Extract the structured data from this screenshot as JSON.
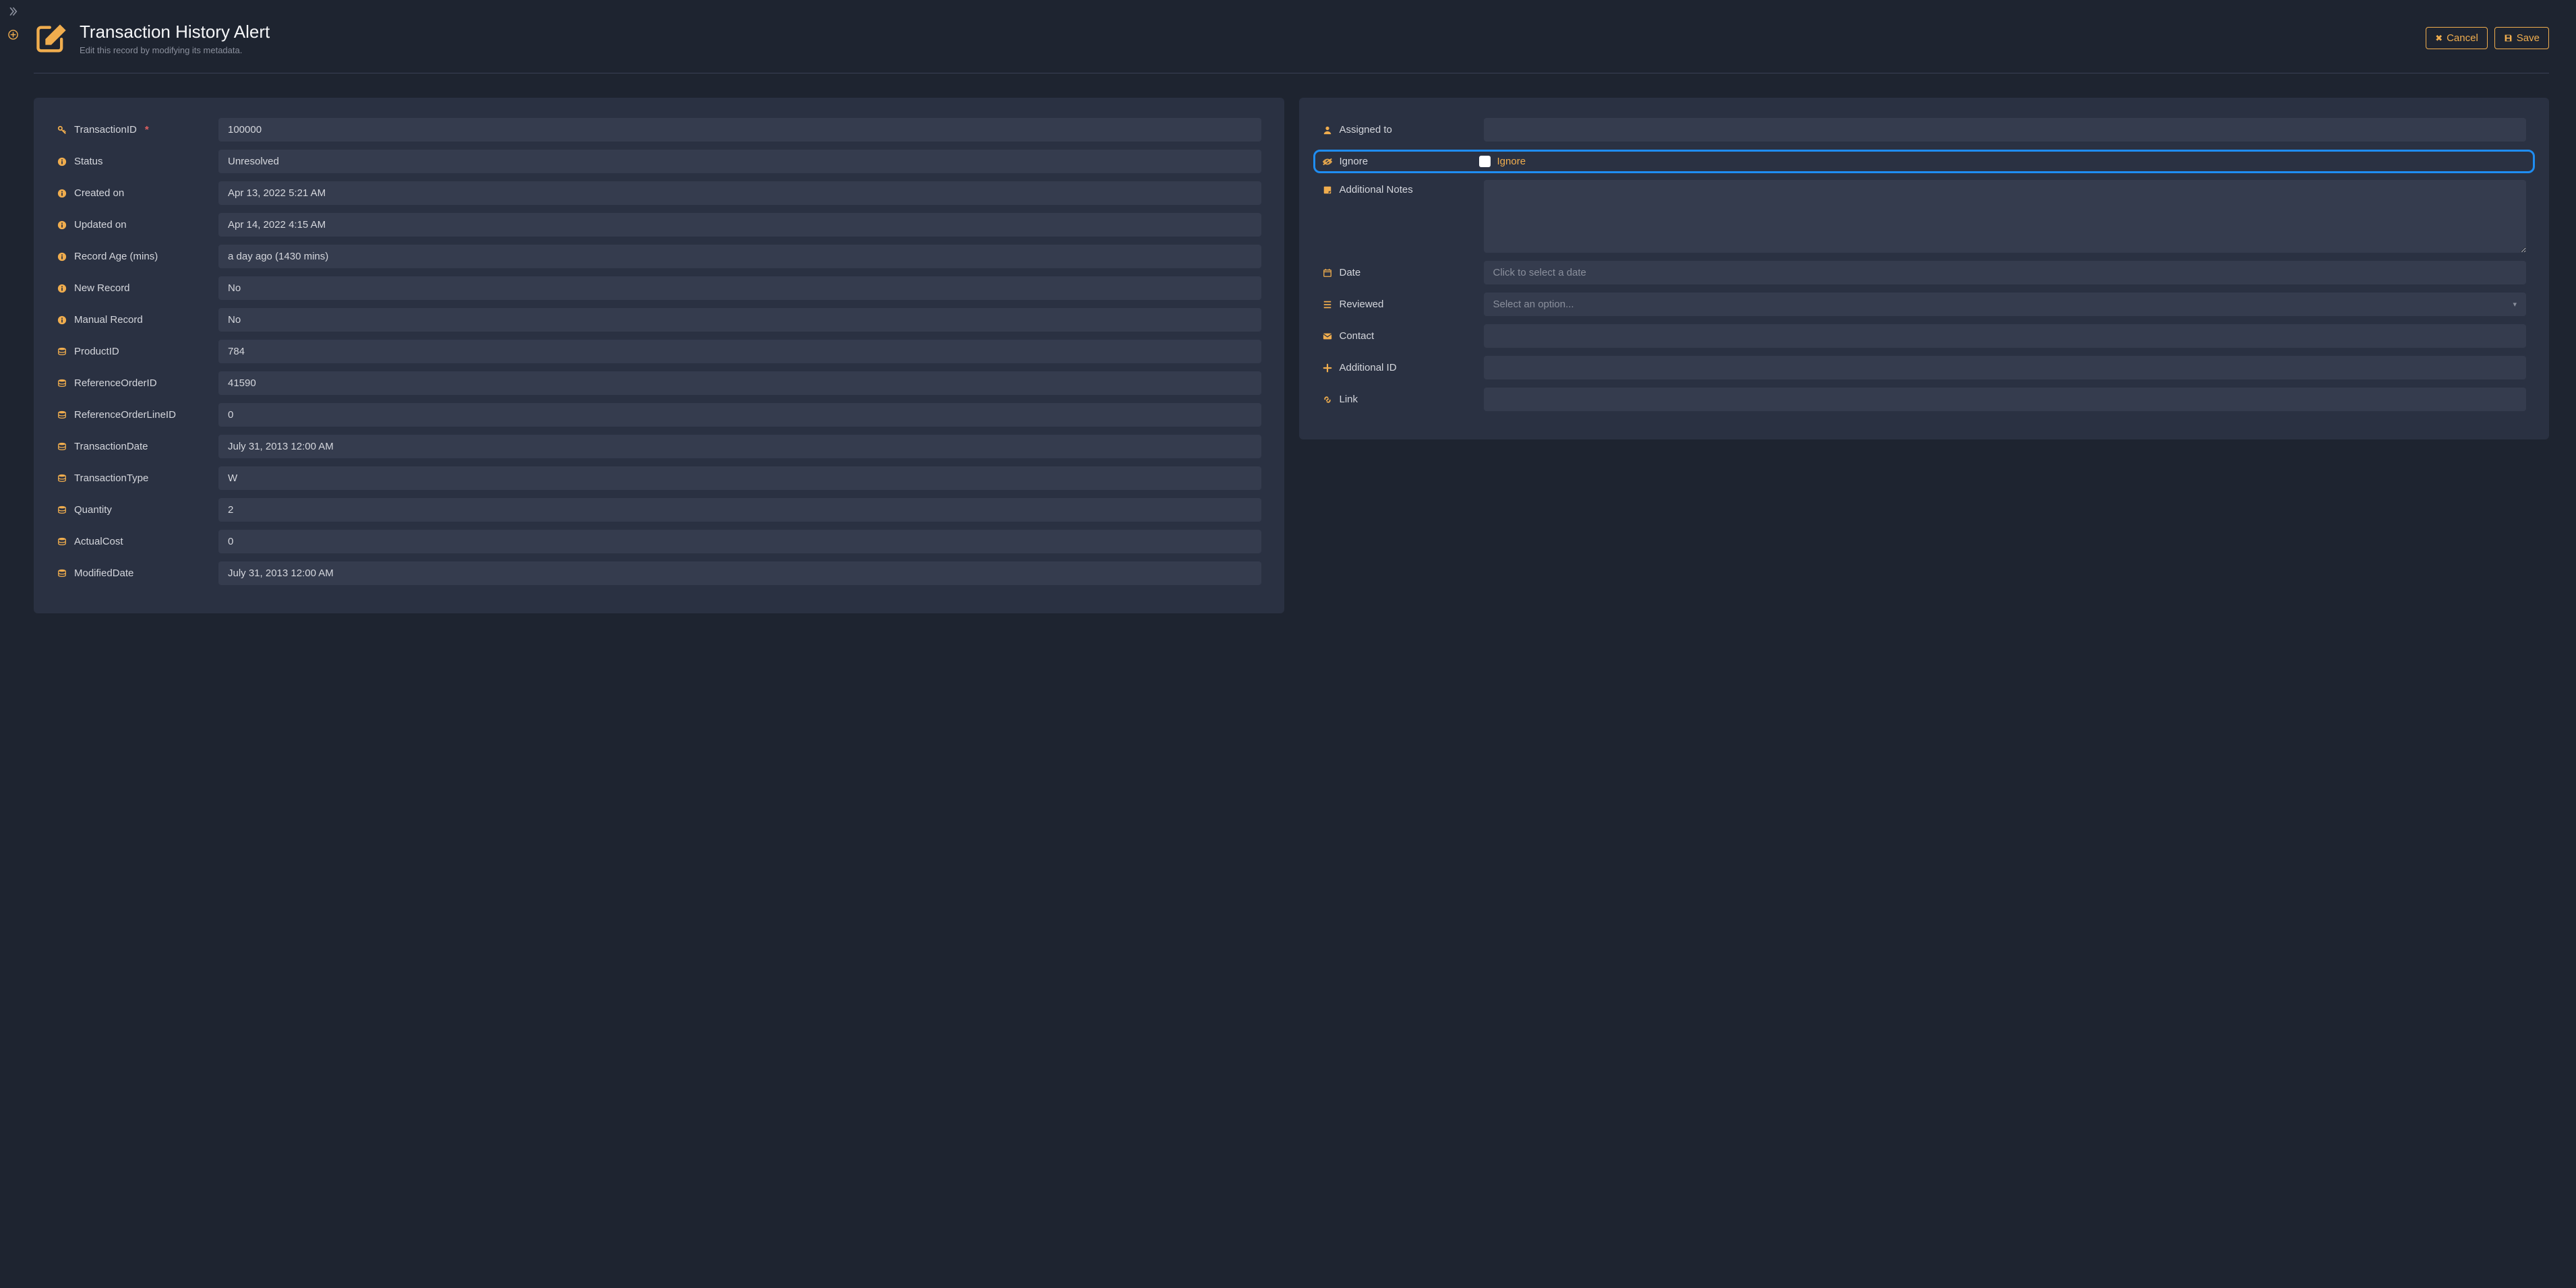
{
  "header": {
    "title": "Transaction History Alert",
    "subtitle": "Edit this record by modifying its metadata.",
    "cancel_label": "Cancel",
    "save_label": "Save"
  },
  "left_panel": {
    "fields": {
      "transaction_id": {
        "label": "TransactionID",
        "value": "100000",
        "required": true,
        "icon": "key"
      },
      "status": {
        "label": "Status",
        "value": "Unresolved",
        "required": false,
        "icon": "info"
      },
      "created_on": {
        "label": "Created on",
        "value": "Apr 13, 2022 5:21 AM",
        "icon": "info"
      },
      "updated_on": {
        "label": "Updated on",
        "value": "Apr 14, 2022 4:15 AM",
        "icon": "info"
      },
      "record_age": {
        "label": "Record Age (mins)",
        "value": "a day ago (1430 mins)",
        "icon": "info"
      },
      "new_record": {
        "label": "New Record",
        "value": "No",
        "icon": "info"
      },
      "manual_record": {
        "label": "Manual Record",
        "value": "No",
        "icon": "info"
      },
      "product_id": {
        "label": "ProductID",
        "value": "784",
        "icon": "database"
      },
      "reference_order_id": {
        "label": "ReferenceOrderID",
        "value": "41590",
        "icon": "database"
      },
      "reference_order_line": {
        "label": "ReferenceOrderLineID",
        "value": "0",
        "icon": "database"
      },
      "transaction_date": {
        "label": "TransactionDate",
        "value": "July 31, 2013 12:00 AM",
        "icon": "database"
      },
      "transaction_type": {
        "label": "TransactionType",
        "value": "W",
        "icon": "database"
      },
      "quantity": {
        "label": "Quantity",
        "value": "2",
        "icon": "database"
      },
      "actual_cost": {
        "label": "ActualCost",
        "value": "0",
        "icon": "database"
      },
      "modified_date": {
        "label": "ModifiedDate",
        "value": "July 31, 2013 12:00 AM",
        "icon": "database"
      }
    }
  },
  "right_panel": {
    "assigned_to": {
      "label": "Assigned to",
      "icon": "user",
      "value": ""
    },
    "ignore": {
      "label": "Ignore",
      "icon": "eye-slash",
      "checkbox_label": "Ignore",
      "checked": false
    },
    "additional_notes": {
      "label": "Additional Notes",
      "icon": "note",
      "value": ""
    },
    "date": {
      "label": "Date",
      "icon": "calendar",
      "placeholder": "Click to select a date",
      "value": ""
    },
    "reviewed": {
      "label": "Reviewed",
      "icon": "list",
      "placeholder": "Select an option...",
      "value": ""
    },
    "contact": {
      "label": "Contact",
      "icon": "envelope",
      "value": ""
    },
    "additional_id": {
      "label": "Additional ID",
      "icon": "plus",
      "value": ""
    },
    "link": {
      "label": "Link",
      "icon": "link",
      "value": ""
    }
  }
}
